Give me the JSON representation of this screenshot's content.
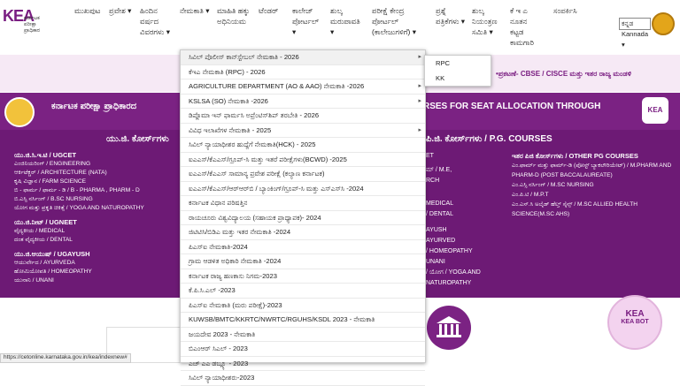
{
  "header": {
    "logo_text": "KEA",
    "logo_sub": "ಕರ್ನಾಟಕ ಪರೀಕ್ಷಾ ಪ್ರಾಧಿಕಾರ",
    "nav": [
      {
        "label": "ಮುಖಪುಟ"
      },
      {
        "label": "ಪ್ರವೇಶ ▾"
      },
      {
        "label": "ಹಿಂದಿನ ವರ್ಷದ ವಿವರಗಳು ▾"
      },
      {
        "label": "ನೇಮಕಾತಿ ▾"
      },
      {
        "label": "ಮಾಹಿತಿ ಹಕ್ಕು ಅಧಿನಿಯಮ"
      },
      {
        "label": "ಟೆಂಡರ್"
      },
      {
        "label": "ಕಾಲೇಜ್ ಪೋರ್ಟಲ್ ▾"
      },
      {
        "label": "ಶುಲ್ಕ ಮರುಪಾವತಿ ▾"
      },
      {
        "label": "ಪರೀಕ್ಷೆ ಕೇಂದ್ರ ಪೋರ್ಟಲ್ (ಕಾಲೇಜುಗಳಿಗೆ) ▾"
      },
      {
        "label": "ಪ್ರಶ್ನೆ ಪತ್ರಿಕೆಗಳು ▾"
      },
      {
        "label": "ಶುಲ್ಕ ನಿಯಂತ್ರಣ ಸಮಿತಿ ▾"
      },
      {
        "label": "ಕೆ ಇ ಎ ನೂತನ ಕಟ್ಟಡ ಕಾಮಗಾರಿ"
      },
      {
        "label": "ಸಂಪರ್ಕಿಸಿ"
      }
    ],
    "language_select": "ಕನ್ನಡ Kannada ▾"
  },
  "ticker": "•ಪ್ರಕಟಣೆ- CBSE / CISCE ಮತ್ತು ಇತರ ರಾಜ್ಯ ಮಂಡಳಿ",
  "banner": {
    "left_title": "ಕರ್ನಾಟಕ ಪರೀಕ್ಷಾ ಪ್ರಾಧಿಕಾರದ",
    "right_title": "RSES FOR SEAT ALLOCATION THROUGH",
    "ug_heading": "ಯು.ಜಿ. ಕೋರ್ಸ್‌ಗಳು",
    "pg_heading": "ಪಿ.ಜಿ. ಕೋರ್ಸ್‌ಗಳು / P.G. COURSES",
    "ug_col": [
      {
        "head": "ಯು.ಜಿ.ಸಿ.ಇ.ಟಿ / UGCET",
        "items": [
          "ಎಂಜಿನಿಯರಿಂಗ್ / ENGINEERING",
          "ಆರ್ಕಿಟೆಕ್ಚರ್ / ARCHITECTURE (NATA)",
          "ಕೃಷಿ ವಿಜ್ಞಾನ / FARM SCIENCE",
          "ಬಿ - ಫಾರ್ಮ / ಫಾರ್ಮ - ಡಿ / B - PHARMA , PHARM - D",
          "ಬಿ.ಎಸ್ಸಿ ನರ್ಸಿಂಗ್ / B.SC NURSING",
          "ಯೋಗ ಮತ್ತು ಪ್ರಕೃತಿ ಚಿಕಿತ್ಸೆ / YOGA AND NATUROPATHY"
        ]
      },
      {
        "head": "ಯು.ಜಿ.ನೀಟ್ / UGNEET",
        "items": [
          "ವೈದ್ಯಕೀಯ / MEDICAL",
          "ದಂತ ವೈದ್ಯಕೀಯ / DENTAL"
        ]
      },
      {
        "head": "ಯು.ಜಿ.ಆಯುಷ್ / UGAYUSH",
        "items": [
          "ಆಯುರ್ವೇದ / AYURVEDA",
          "ಹೋಮಿಯೋಪತಿ / HOMEOPATHY",
          "ಯುನಾನಿ / UNANI"
        ]
      }
    ],
    "mid_col": [
      "ET",
      "ಮ್ / M.E,",
      "RCH",
      "MEDICAL",
      "/ DENTAL",
      "AYUSH",
      "AYURVED",
      "/ HOMEOPATHY",
      "UNANI",
      "/ ಯೋಗ / YOGA AND",
      "NATUROPATHY"
    ],
    "pg_col": {
      "head": "ಇತರ ಪಿಜಿ ಕೋರ್ಸ್‌ಗಳು / OTHER PG COURSES",
      "items": [
        "ಎಂ.ಫಾರ್ಮ್ ಮತ್ತು ಫಾರ್ಮ್-ಡಿ (ಪೋಸ್ಟ್ ಬ್ಯಾಕಲೌರಿಯೇಟ್) / M.PHARM AND PHARM-D (POST BACCALAUREATE)",
        "ಎಂ.ಎಸ್ಸಿ ನರ್ಸಿಂಗ್ / M.SC NURSING",
        "ಎಂ.ಪಿ.ಟಿ / M.P.T",
        "ಎಂ.ಎಸ್.ಸಿ ಅಲೈಡ್ ಹೆಲ್ತ್ ಸೈನ್ಸ್ / M.SC ALLIED HEALTH SCIENCE(M.SC AHS)"
      ]
    }
  },
  "dropdown": {
    "items": [
      {
        "label": "ಸಿವಿಲ್ ಪೊಲೀಸ್ ಕಾನ್‌ಸ್ಟೇಬಲ್ ನೇಮಕಾತಿ - 2026",
        "has_sub": true
      },
      {
        "label": "ಕೆಇಎ ನೇಮಕಾತಿ (RPC) - 2026",
        "has_sub": false
      },
      {
        "label": "AGRICULTURE DEPARTMENT (AO & AAO) ನೇಮಕಾತಿ -2026",
        "has_sub": true
      },
      {
        "label": "KSLSA (SO) ನೇಮಕಾತಿ -2026",
        "has_sub": true
      },
      {
        "label": "ಡಿಪ್ಲೊಮಾ ಇನ್ ಫಾರ್ಮಸಿ ಅಪ್ರೆಂಟಿಸ್‌ಶಿಪ್ ತರಬೇತಿ - 2026",
        "has_sub": false
      },
      {
        "label": "ವಿವಿಧ ಇಲಾಖೆಗಳ ನೇಮಕಾತಿ - 2025",
        "has_sub": true
      },
      {
        "label": "ಸಿವಿಲ್ ನ್ಯಾಯಾಧೀಶರ ಹುದ್ದೆಗೆ ನೇಮಕಾತಿ(HCK) - 2025",
        "has_sub": false
      },
      {
        "label": "ಐಎಎಸ್/ಕೆಎಎಸ್/ಗ್ರೂಪ್-ಸಿ ಮತ್ತು ಇತರೆ ಪರೀಕ್ಷೆಗಳು(BCWD) -2025",
        "has_sub": false
      },
      {
        "label": "ಐಎಎಸ್/ಕೆಎಎಸ್ ಸಾಮಾನ್ಯ ಪ್ರವೇಶ ಪರೀಕ್ಷೆ (ಕಲ್ಯಾಣ ಕರ್ನಾಟಕ)",
        "has_sub": false
      },
      {
        "label": "ಐಎಎಸ್/ಕೆಎಎಸ್/ಆರ್‌ಆರ್‌ಬಿ / ಬ್ಯಾಂಕಿಂಗ್/ಗ್ರೂಪ್-ಸಿ ಮತ್ತು ಎಸ್ಎಸ್‌ಸಿ -2024",
        "has_sub": false
      },
      {
        "label": "ಕರ್ನಾಟಕ ವಿಧಾನ ಪರಿಷತ್ತಿನ",
        "has_sub": false
      },
      {
        "label": "ರಾಯಚೂರು ವಿಶ್ವವಿದ್ಯಾಲಯ (ಸಹಾಯಕ ಪ್ರಾಧ್ಯಾಪಕ)- 2024",
        "has_sub": false
      },
      {
        "label": "ಜಿಟಿಟಿಸಿ/ಬಿಡಿಎ ಮತ್ತು ಇತರ ನೇಮಕಾತಿ -2024",
        "has_sub": false
      },
      {
        "label": "ಪಿಎಸ್‌ಐ ನೇಮಕಾತಿ-2024",
        "has_sub": false
      },
      {
        "label": "ಗ್ರಾಮ ಆಡಳಿತ ಅಧಿಕಾರಿ ನೇಮಕಾತಿ -2024",
        "has_sub": false
      },
      {
        "label": "ಕರ್ನಾಟಕ ರಾಜ್ಯ ಹಣಕಾಸು ನಿಗಮ-2023",
        "has_sub": false
      },
      {
        "label": "ಕೆ.ಪಿ.ಸಿ.ಎಲ್ -2023",
        "has_sub": false
      },
      {
        "label": "ಪಿಎಸ್‌ಐ ನೇಮಕಾತಿ (ಮರು ಪರೀಕ್ಷೆ)-2023",
        "has_sub": false
      },
      {
        "label": "KUWSB/BMTC/KKRTC/NWRTC/RGUHS/KSDL 2023 - ನೇಮಕಾತಿ",
        "has_sub": false
      },
      {
        "label": "ಜಯದೇವ 2023 - ನೇಮಕಾತಿ",
        "has_sub": false
      },
      {
        "label": "ಬಿಎಂಆರ್ ಸಿಎಲ್ - 2023",
        "has_sub": false
      },
      {
        "label": "ಎಚ್ ಎಎ ಡಬ್ಲ್ಯೂ - 2023",
        "has_sub": false
      },
      {
        "label": "ಸಿವಿಲ್ ನ್ಯಾಯಾಧೀಶರು-2023",
        "has_sub": false
      }
    ],
    "submenu": [
      "RPC",
      "KK"
    ]
  },
  "kea_bot_label": "KEA BOT",
  "status_url": "https://cetonline.karnataka.gov.in/kea/indexnew#"
}
